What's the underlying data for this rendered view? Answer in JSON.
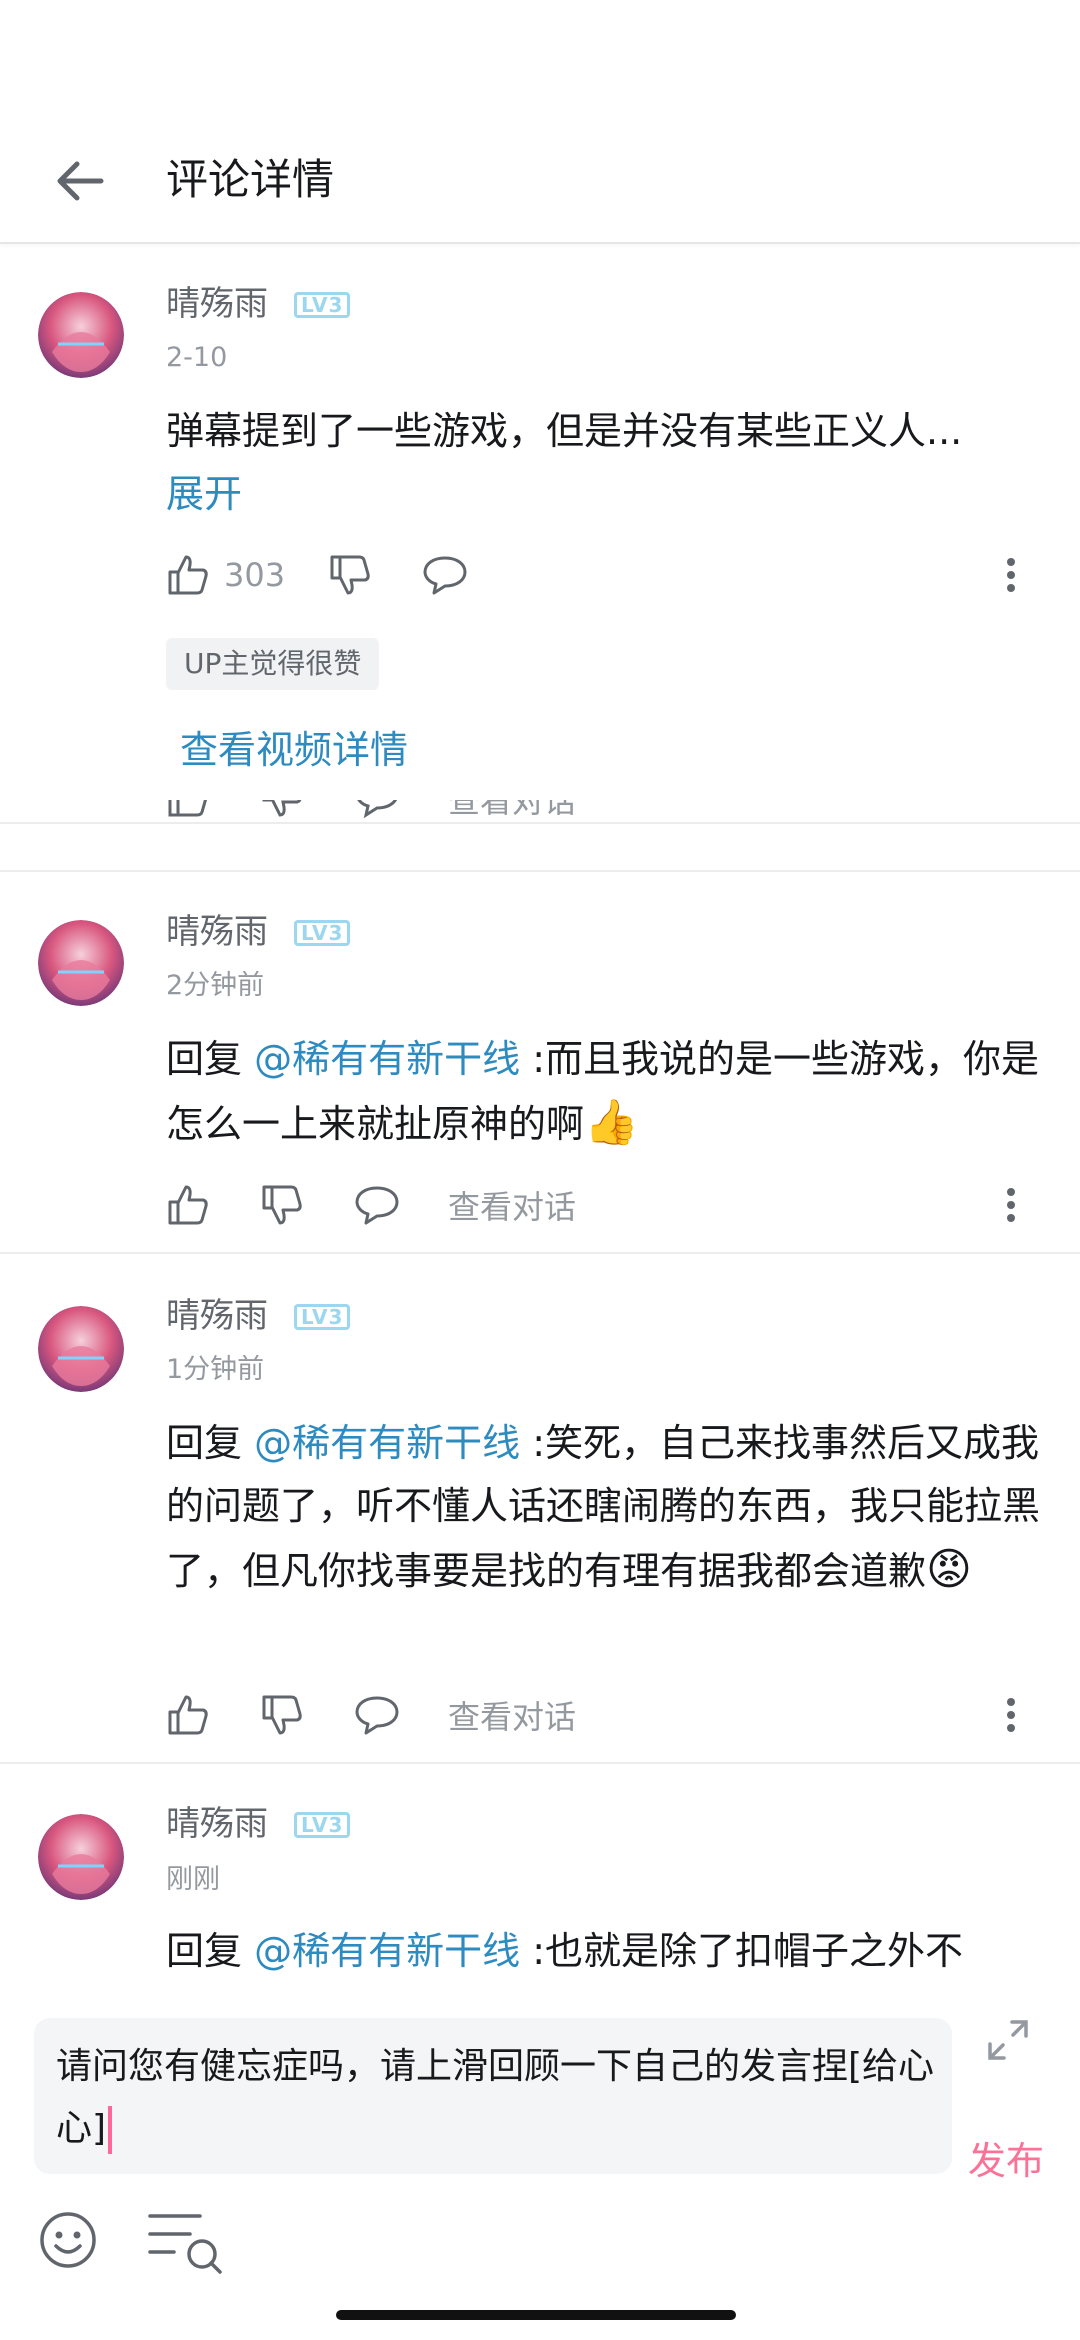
{
  "header": {
    "title": "评论详情",
    "back_icon": "arrow-left-icon"
  },
  "main_comment": {
    "username": "晴殇雨",
    "level": "LV3",
    "time": "2-10",
    "text": "弹幕提到了一些游戏，但是并没有某些正义人...",
    "expand_label": "展开",
    "like_count": "303",
    "up_badge": "UP主觉得很赞",
    "view_video_label": "查看视频详情",
    "cut_conversation_label": "查看对话"
  },
  "replies": [
    {
      "username": "晴殇雨",
      "level": "LV3",
      "time": "2分钟前",
      "prefix": "回复 ",
      "mention": "@稀有有新干线",
      "text": " :而且我说的是一些游戏，你是怎么一上来就扯原神的啊",
      "emoji": "👍",
      "conversation_label": "查看对话"
    },
    {
      "username": "晴殇雨",
      "level": "LV3",
      "time": "1分钟前",
      "prefix": "回复 ",
      "mention": "@稀有有新干线",
      "text": " :笑死，自己来找事然后又成我的问题了，听不懂人话还瞎闹腾的东西，我只能拉黑了，但凡你找事要是找的有理有据我都会道歉",
      "emoji": "😡",
      "conversation_label": "查看对话"
    },
    {
      "username": "晴殇雨",
      "level": "LV3",
      "time": "刚刚",
      "prefix": "回复 ",
      "mention": "@稀有有新干线",
      "text": " :也就是除了扣帽子之外不"
    }
  ],
  "input": {
    "text": "请问您有健忘症吗，请上滑回顾一下自己的发言捏[给心心]",
    "publish_label": "发布"
  },
  "colors": {
    "link": "#2e8bc0",
    "accent": "#fb7299",
    "level": "#9cd7f0"
  }
}
